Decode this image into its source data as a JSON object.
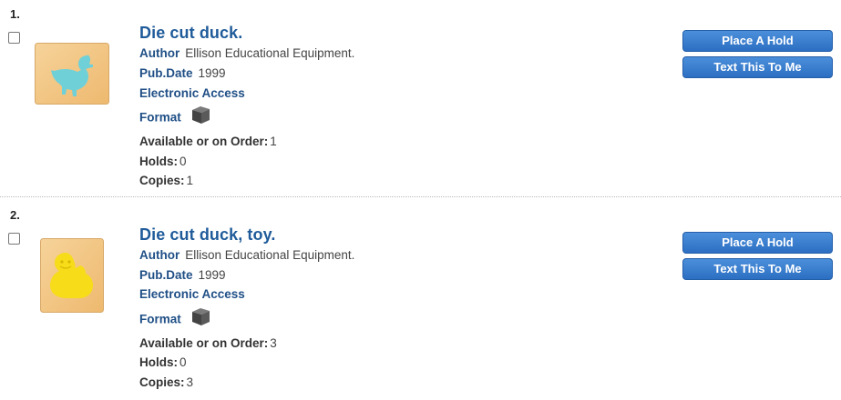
{
  "results": [
    {
      "number": "1.",
      "title": "Die cut duck.",
      "author_label": "Author",
      "author": "Ellison Educational Equipment.",
      "pubdate_label": "Pub.Date",
      "pubdate": "1999",
      "electronic_access": "Electronic Access",
      "format_label": "Format",
      "format_icon": "cube-icon",
      "available_label": "Available or on Order:",
      "available": "1",
      "holds_label": "Holds:",
      "holds": "0",
      "copies_label": "Copies:",
      "copies": "1",
      "place_hold": "Place A Hold",
      "text_me": "Text This To Me",
      "image_color": "#6fd0d8"
    },
    {
      "number": "2.",
      "title": "Die cut duck, toy.",
      "author_label": "Author",
      "author": "Ellison Educational Equipment.",
      "pubdate_label": "Pub.Date",
      "pubdate": "1999",
      "electronic_access": "Electronic Access",
      "format_label": "Format",
      "format_icon": "cube-icon",
      "available_label": "Available or on Order:",
      "available": "3",
      "holds_label": "Holds:",
      "holds": "0",
      "copies_label": "Copies:",
      "copies": "3",
      "place_hold": "Place A Hold",
      "text_me": "Text This To Me",
      "image_color": "#f7dc1a"
    }
  ],
  "colors": {
    "link": "#1f5b9a",
    "button": "#2c6fc2",
    "wood": "#f3c98a"
  }
}
